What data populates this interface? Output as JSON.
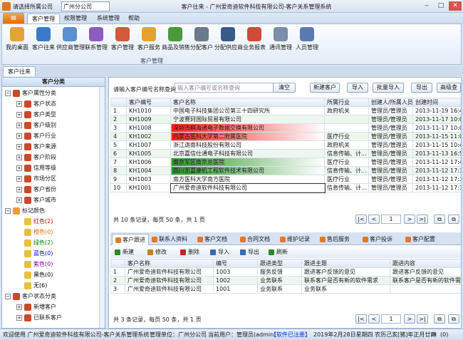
{
  "titlebar": {
    "company_label": "请选择所属公司",
    "company_value": "广州分公司",
    "title": "客户往来 - 广州爱奇迪软件科技有限公司-客户关系管理系统"
  },
  "menu": {
    "file": "",
    "tabs": [
      "客户管理",
      "权限管理",
      "系统管理",
      "帮助"
    ]
  },
  "ribbon": {
    "group": "客户管理",
    "buttons": [
      {
        "label": "我的桌面",
        "icon": "desktop-icon",
        "color": "#e3a23a"
      },
      {
        "label": "客户往来",
        "icon": "users-icon",
        "color": "#3a7bc8"
      },
      {
        "label": "供应商管理",
        "icon": "supplier-icon",
        "color": "#5a8fd0"
      },
      {
        "label": "联系管理",
        "icon": "contact-icon",
        "color": "#8e5bbf"
      },
      {
        "label": "客户管理",
        "icon": "customer-icon",
        "color": "#d05a3a"
      },
      {
        "label": "客户服务",
        "icon": "service-icon",
        "color": "#e6a12e"
      },
      {
        "label": "商品及销售",
        "icon": "goods-icon",
        "color": "#4a9a3c"
      },
      {
        "label": "分配客户",
        "icon": "eye-icon",
        "color": "#6a7a8a"
      },
      {
        "label": "分配供应商",
        "icon": "binoculars-icon",
        "color": "#3a5a8a"
      },
      {
        "label": "业务报表",
        "icon": "report-icon",
        "color": "#d04a3a"
      },
      {
        "label": "通讯管理",
        "icon": "comm-icon",
        "color": "#7a8fa8"
      },
      {
        "label": "人员管理",
        "icon": "person-card-icon",
        "color": "#5a7ab0"
      }
    ]
  },
  "doctab": "客户往来",
  "tree": {
    "header": "客户分类",
    "nodes": [
      {
        "t": "客户属性分类",
        "lv": 0,
        "exp": "−",
        "ic": "#c84a2a"
      },
      {
        "t": "客户状态",
        "lv": 1,
        "exp": "+",
        "ic": "#c84a2a"
      },
      {
        "t": "客户类型",
        "lv": 1,
        "exp": "+",
        "ic": "#c84a2a"
      },
      {
        "t": "客户级别",
        "lv": 1,
        "exp": "+",
        "ic": "#c84a2a"
      },
      {
        "t": "客户行业",
        "lv": 1,
        "exp": "+",
        "ic": "#c84a2a"
      },
      {
        "t": "客户来源",
        "lv": 1,
        "exp": "+",
        "ic": "#c84a2a"
      },
      {
        "t": "客户阶段",
        "lv": 1,
        "exp": "+",
        "ic": "#c84a2a"
      },
      {
        "t": "信用等级",
        "lv": 1,
        "exp": "+",
        "ic": "#c84a2a"
      },
      {
        "t": "市场分区",
        "lv": 1,
        "exp": "+",
        "ic": "#c84a2a"
      },
      {
        "t": "客户省份",
        "lv": 1,
        "exp": "+",
        "ic": "#c84a2a"
      },
      {
        "t": "客户城市",
        "lv": 1,
        "exp": "+",
        "ic": "#c84a2a"
      },
      {
        "t": "标记颜色",
        "lv": 0,
        "exp": "−",
        "ic": "#e6a12e"
      },
      {
        "t": "红色(2)",
        "lv": 1,
        "exp": "",
        "ic": "#e6c23a",
        "c": "#d00000"
      },
      {
        "t": "橙色(0)",
        "lv": 1,
        "exp": "",
        "ic": "#e6c23a",
        "c": "#e07000"
      },
      {
        "t": "绿色(2)",
        "lv": 1,
        "exp": "",
        "ic": "#e6c23a",
        "c": "#008000"
      },
      {
        "t": "蓝色(0)",
        "lv": 1,
        "exp": "",
        "ic": "#e6c23a",
        "c": "#0000d0"
      },
      {
        "t": "紫色(0)",
        "lv": 1,
        "exp": "",
        "ic": "#e6c23a",
        "c": "#8000a0"
      },
      {
        "t": "黑色(0)",
        "lv": 1,
        "exp": "",
        "ic": "#e6c23a",
        "c": "#000"
      },
      {
        "t": "无(6)",
        "lv": 1,
        "exp": "",
        "ic": "#e6c23a",
        "c": "#000"
      },
      {
        "t": "客户状态分类",
        "lv": 0,
        "exp": "−",
        "ic": "#c84a2a"
      },
      {
        "t": "新増客户",
        "lv": 1,
        "exp": "+",
        "ic": "#c84a2a"
      },
      {
        "t": "已联系客户",
        "lv": 1,
        "exp": "+",
        "ic": "#c84a2a"
      }
    ]
  },
  "query": {
    "label": "请输入客户编号名称查询",
    "placeholder": "输入客户编号或名称查询",
    "clear": "清空"
  },
  "actions": [
    "新建客户",
    "导入",
    "批量导入",
    "导出",
    "高级查"
  ],
  "grid1": {
    "headers": [
      "",
      "客户编号",
      "客户名称",
      "所属行业",
      "创建人/所属人员",
      "创建时间"
    ],
    "rows": [
      {
        "n": "1",
        "id": "KH1010",
        "name": "中国电子科技集团公司第三十四研究所",
        "ind": "政府机关",
        "who": "管理员/管理员",
        "time": "2013-11-19 16:40",
        "hl": ""
      },
      {
        "n": "2",
        "id": "KH1009",
        "name": "宁波赛珂国际贸易有限公司",
        "ind": "",
        "who": "管理员/管理员",
        "time": "2013-11-17 10:08",
        "hl": ""
      },
      {
        "n": "3",
        "id": "KH1008",
        "name": "深圳市麒海通电子数据交换有限公司",
        "ind": "",
        "who": "管理员/管理员",
        "time": "2013-11-17 10:00",
        "hl": "red"
      },
      {
        "n": "4",
        "id": "KH1002",
        "name": "内蒙古医科大学第二附属医院",
        "ind": "医疗行业",
        "who": "管理员/管理员",
        "time": "2013-11-15 11:00",
        "hl": "red"
      },
      {
        "n": "5",
        "id": "KH1007",
        "name": "浙江迦南科技股份有限公司",
        "ind": "政府机关",
        "who": "管理员/管理员",
        "time": "2013-11-15 10:42",
        "hl": ""
      },
      {
        "n": "6",
        "id": "KH1005",
        "name": "北京嘉信仕通电子科技有限公司",
        "ind": "信息传输、计...",
        "who": "管理员/管理员",
        "time": "2013-11-13 16:51",
        "hl": ""
      },
      {
        "n": "7",
        "id": "KH1006",
        "name": "南京军区南京总医院",
        "ind": "医疗行业",
        "who": "管理员/管理员",
        "time": "2013-11-12 17:46",
        "hl": "green"
      },
      {
        "n": "8",
        "id": "KH1004",
        "name": "四川凯嘉康机工程软件技术有限公司",
        "ind": "信息传输、计...",
        "who": "管理员/管理员",
        "time": "2013-11-12 17:35",
        "hl": "green"
      },
      {
        "n": "9",
        "id": "KH1003",
        "name": "南方医科大学南方医院",
        "ind": "医疗行业",
        "who": "管理员/管理员",
        "time": "2013-11-12 17:33",
        "hl": ""
      },
      {
        "n": "10",
        "id": "KH1001",
        "name": "广州爱奇迪软件科技有限公司",
        "ind": "信息传输、计...",
        "who": "管理员/管理员",
        "time": "2013-11-12 17:32",
        "hl": "sel"
      }
    ]
  },
  "pager1": {
    "summary": "共 10 条记录，每页 50 条，共 1 页",
    "page": "1"
  },
  "subtabs": [
    "客户跟进",
    "联系人资料",
    "客户文档",
    "合同文档",
    "维护记录",
    "售后服务",
    "客户投诉",
    "客户配置"
  ],
  "subtools": [
    "新建",
    "修改",
    "删除",
    "导入",
    "导出",
    "刷新"
  ],
  "grid2": {
    "headers": [
      "",
      "客户名称",
      "编号",
      "跟进类型",
      "跟进主题",
      "跟进内容"
    ],
    "rows": [
      {
        "n": "1",
        "name": "广州爱奇迪软件科技有限公司",
        "id": "1003",
        "type": "服务反馈",
        "topic": "跟进客户反馈的意见",
        "content": "跟进客户反馈的意见"
      },
      {
        "n": "2",
        "name": "广州爱奇迪软件科技有限公司",
        "id": "1002",
        "type": "业务联系",
        "topic": "联系客户是否有新的软件需求",
        "content": "联系客户是否有新的软件需求"
      },
      {
        "n": "3",
        "name": "广州爱奇迪软件科技有限公司",
        "id": "1001",
        "type": "业务联系",
        "topic": "业务联系",
        "content": ""
      }
    ]
  },
  "pager2": {
    "summary": "共 3 条记录，每页 50 条，共 1 页",
    "page": "1"
  },
  "status": {
    "welcome": "欢迎使用 广州爱奇迪软件科技有限公司-客户关系管理系统",
    "unit": "管理单位：广州分公司",
    "user": "当前用户：管理员(admin)",
    "register": "【软件已注册】",
    "date": "2019年2月28日星期四 农历己亥[猪]年正月廿四",
    "count": "(0)"
  }
}
